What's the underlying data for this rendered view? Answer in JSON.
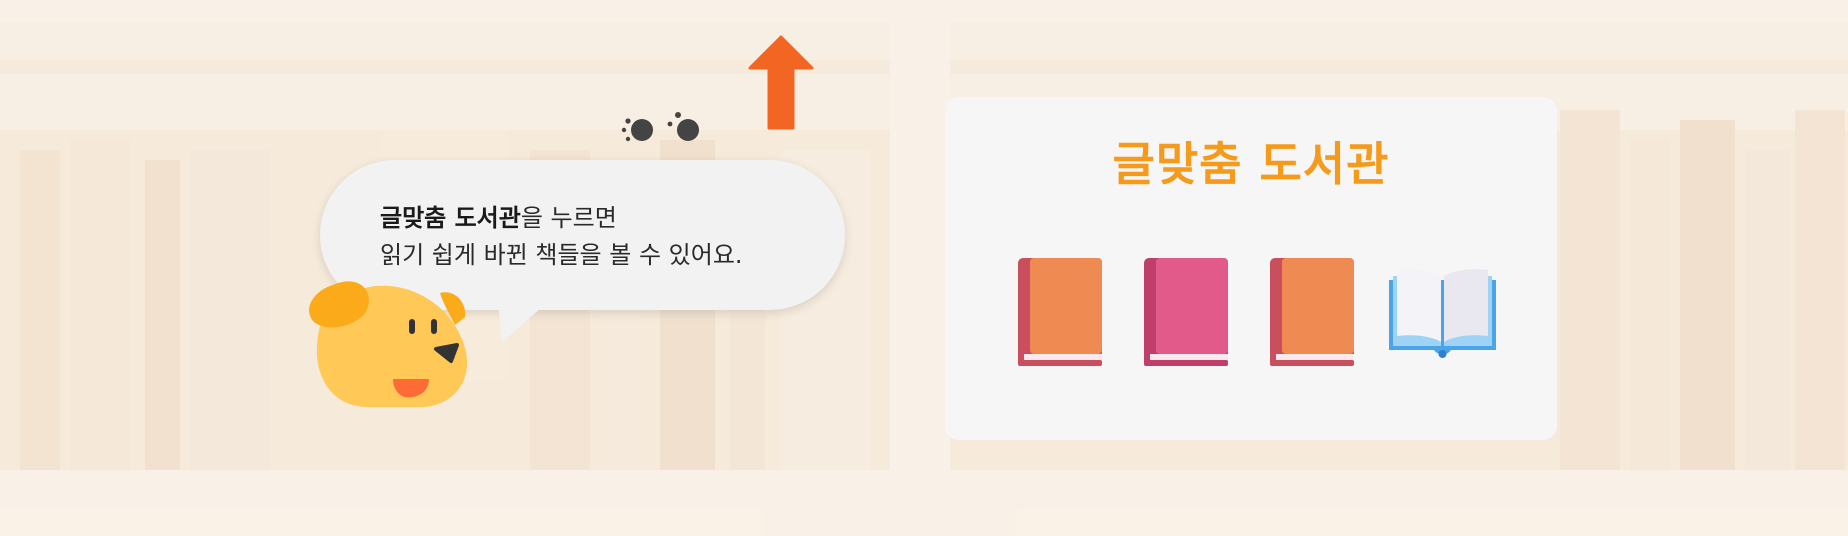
{
  "bubble": {
    "bold_label": "글맞춤 도서관",
    "line1_rest": "을 누르면",
    "line2": "읽기 쉽게 바뀐 책들을 볼 수 있어요."
  },
  "card": {
    "title": "글맞춤 도서관",
    "books": [
      {
        "color": "#ee8a52",
        "spine": "#c94f5e"
      },
      {
        "color": "#e25a8a",
        "spine": "#c03e6a"
      },
      {
        "color": "#ee8a52",
        "spine": "#c94f5e"
      }
    ]
  },
  "colors": {
    "accent_orange": "#f59a1a",
    "arrow": "#f26522",
    "dog": "#ffc857",
    "dog_ear": "#fbab1a"
  },
  "icons": [
    "shelf-background",
    "dog-icon",
    "up-arrow-icon",
    "sparkle-icon",
    "book-icon",
    "open-book-icon"
  ]
}
